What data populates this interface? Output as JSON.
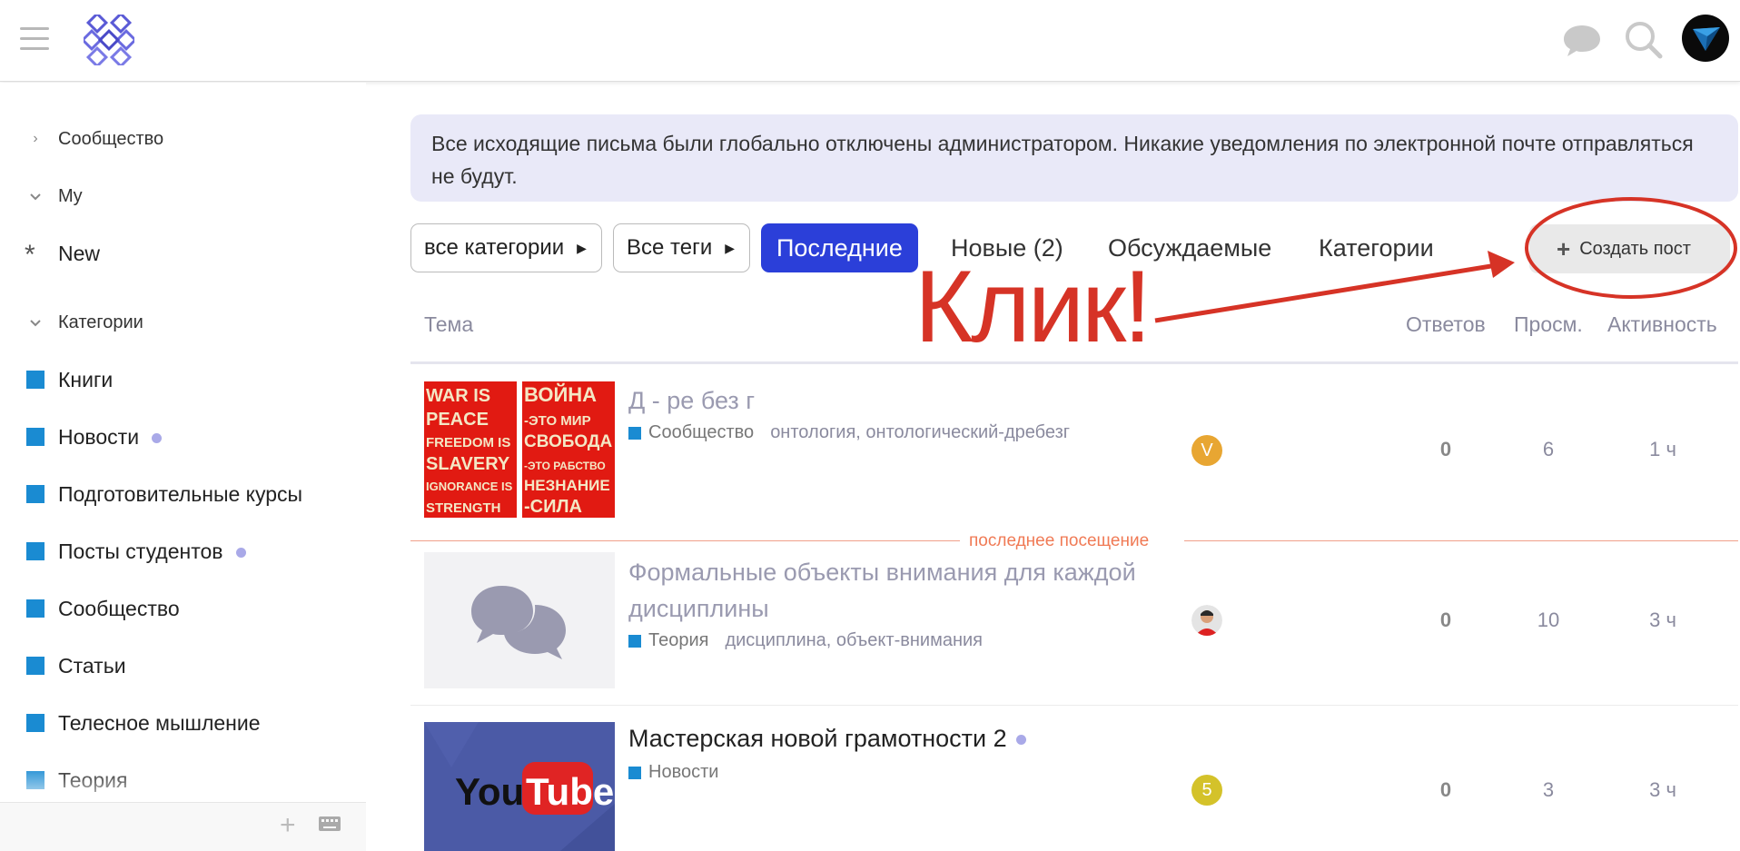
{
  "header": {
    "menu_icon": "hamburger-icon",
    "logo": "site-logo",
    "icons": [
      "chat-icon",
      "search-icon"
    ],
    "user_avatar": "user-avatar"
  },
  "sidebar": {
    "sections": [
      {
        "label": "Сообщество",
        "chevron": "chevron-right-icon"
      },
      {
        "label": "My",
        "chevron": "chevron-down-icon"
      },
      {
        "label": "New",
        "icon": "asterisk-icon"
      },
      {
        "label": "Категории",
        "chevron": "chevron-down-icon"
      }
    ],
    "categories": [
      {
        "label": "Книги",
        "new": false
      },
      {
        "label": "Новости",
        "new": true
      },
      {
        "label": "Подготовительные курсы",
        "new": false
      },
      {
        "label": "Посты студентов",
        "new": true
      },
      {
        "label": "Сообщество",
        "new": false
      },
      {
        "label": "Статьи",
        "new": false
      },
      {
        "label": "Телесное мышление",
        "new": false
      },
      {
        "label": "Теория",
        "new": false
      }
    ],
    "category_color": "#1a8bd2",
    "footer_icons": [
      "plus-icon",
      "keyboard-icon"
    ]
  },
  "banner": {
    "text": "Все исходящие письма были глобально отключены администратором. Никакие уведомления по электронной почте отправляться не будут."
  },
  "nav": {
    "categories_dropdown": "все категории",
    "tags_dropdown": "Все теги",
    "tabs": [
      "Последние",
      "Новые (2)",
      "Обсуждаемые",
      "Категории"
    ],
    "active_tab": "Последние",
    "create_button": "Создать пост"
  },
  "annotation": {
    "text": "Клик!",
    "color": "#d63326"
  },
  "table": {
    "columns": [
      "Тема",
      "Ответов",
      "Просм.",
      "Активность"
    ],
    "last_visit_label": "последнее посещение",
    "topics": [
      {
        "title": "Д - ре без г",
        "category": "Сообщество",
        "tags": "онтология, онтологический-дребезг",
        "thumbnail": "war-is-peace-poster",
        "thumbnail_text_left": [
          "WAR IS",
          "PEACE",
          "FREEDOM IS",
          "SLAVERY",
          "IGNORANCE IS",
          "STRENGTH"
        ],
        "thumbnail_text_right": [
          "ВОЙНА",
          "-ЭТО МИР",
          "СВОБОДА",
          "-ЭТО РАБСТВО",
          "НЕЗНАНИЕ",
          "-СИЛА"
        ],
        "poster_initial": "V",
        "poster_color": "#e8a632",
        "replies": "0",
        "views": "6",
        "activity": "1 ч",
        "visited": true
      },
      {
        "title": "Формальные объекты внимания для каждой дисциплины",
        "category": "Теория",
        "tags": "дисциплина, объект-внимания",
        "thumbnail": "chat-bubbles-placeholder",
        "poster_initial": "",
        "poster_color": "#ffffff",
        "replies": "0",
        "views": "10",
        "activity": "3 ч",
        "visited": true
      },
      {
        "title": "Мастерская новой грамотности 2",
        "category": "Новости",
        "tags": "",
        "thumbnail": "youtube-logo",
        "thumbnail_text": [
          "You",
          "Tube"
        ],
        "poster_initial": "5",
        "poster_color": "#d4c22a",
        "replies": "0",
        "views": "3",
        "activity": "3 ч",
        "visited": false
      }
    ]
  }
}
